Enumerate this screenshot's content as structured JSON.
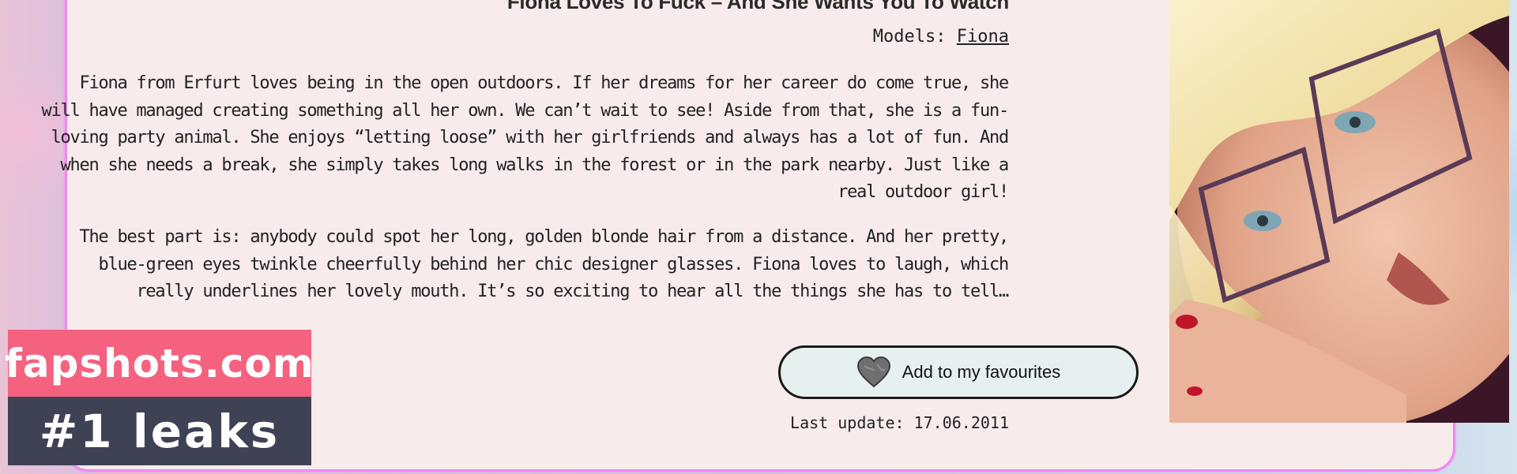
{
  "post": {
    "title": "Fiona Loves To Fuck – And She Wants You To Watch",
    "models_label": "Models:",
    "model_name": "Fiona",
    "paragraph_1": "Fiona from Erfurt loves being in the open outdoors. If her dreams for her career do come true, she will have managed creating something all her own. We can’t wait to see! Aside from that, she is a fun-loving party animal. She enjoys “letting loose” with her girlfriends and always has a lot of fun. And when she needs a break, she simply takes long walks in the forest or in the park nearby. Just like a real outdoor girl!",
    "paragraph_2": "The best part is: anybody could spot her long, golden blonde hair from a distance. And her pretty, blue-green eyes twinkle cheerfully behind her chic designer glasses. Fiona loves to laugh, which really underlines her lovely mouth. It’s so exciting to hear all the things she has to tell…",
    "favourite_button_label": "Add to my favourites",
    "favourite_icon": "heart-icon",
    "last_update": "Last update: 17.06.2011"
  },
  "watermark": {
    "line1": "fapshots.com",
    "line2": "#1 leaks"
  },
  "colors": {
    "card_border": "#ee88f0",
    "card_background": "#f7ebeb",
    "button_background": "#e6f0ef",
    "watermark_pink": "#f4627f",
    "watermark_dark": "#3f4255"
  }
}
